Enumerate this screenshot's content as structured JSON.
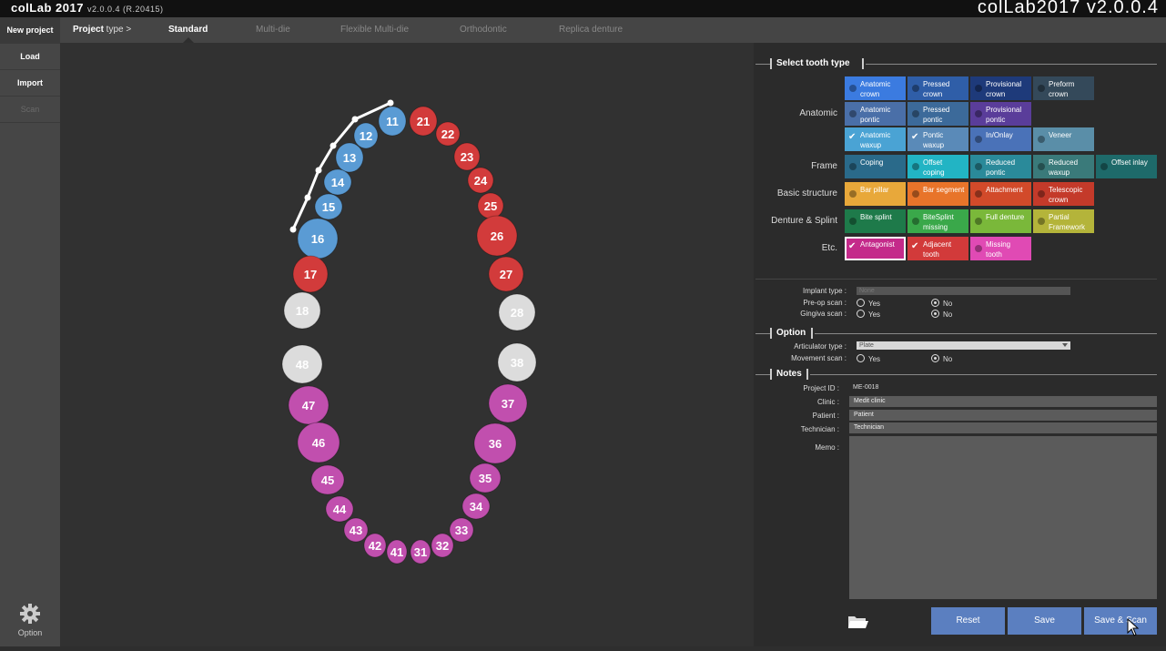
{
  "app": {
    "brand": "colLab 2017",
    "version": "v2.0.0.4 (R.20415)",
    "title_right": "colLab2017 v2.0.0.4"
  },
  "sidebar": {
    "items": [
      {
        "label": "New project"
      },
      {
        "label": "Load"
      },
      {
        "label": "Import"
      },
      {
        "label": "Scan"
      }
    ],
    "option_label": "Option"
  },
  "topbar": {
    "project_type_bold": "Project",
    "project_type_rest": " type >",
    "tabs": [
      "Standard",
      "Multi-die",
      "Flexible Multi-die",
      "Orthodontic",
      "Replica denture"
    ]
  },
  "teeth": {
    "upper": [
      {
        "n": "11",
        "c": "#5a9bd4"
      },
      {
        "n": "12",
        "c": "#5a9bd4"
      },
      {
        "n": "13",
        "c": "#5a9bd4"
      },
      {
        "n": "14",
        "c": "#5a9bd4"
      },
      {
        "n": "15",
        "c": "#5a9bd4"
      },
      {
        "n": "16",
        "c": "#5a9bd4"
      },
      {
        "n": "17",
        "c": "#d23b3b"
      },
      {
        "n": "18",
        "c": "#dcdcdc"
      },
      {
        "n": "21",
        "c": "#d23b3b"
      },
      {
        "n": "22",
        "c": "#d23b3b"
      },
      {
        "n": "23",
        "c": "#d23b3b"
      },
      {
        "n": "24",
        "c": "#d23b3b"
      },
      {
        "n": "25",
        "c": "#d23b3b"
      },
      {
        "n": "26",
        "c": "#d23b3b"
      },
      {
        "n": "27",
        "c": "#d23b3b"
      },
      {
        "n": "28",
        "c": "#dcdcdc"
      }
    ],
    "lower": [
      {
        "n": "48",
        "c": "#dcdcdc"
      },
      {
        "n": "47",
        "c": "#c14fae"
      },
      {
        "n": "46",
        "c": "#c14fae"
      },
      {
        "n": "45",
        "c": "#c14fae"
      },
      {
        "n": "44",
        "c": "#c14fae"
      },
      {
        "n": "43",
        "c": "#c14fae"
      },
      {
        "n": "42",
        "c": "#c14fae"
      },
      {
        "n": "41",
        "c": "#c14fae"
      },
      {
        "n": "31",
        "c": "#c14fae"
      },
      {
        "n": "32",
        "c": "#c14fae"
      },
      {
        "n": "33",
        "c": "#c14fae"
      },
      {
        "n": "34",
        "c": "#c14fae"
      },
      {
        "n": "35",
        "c": "#c14fae"
      },
      {
        "n": "36",
        "c": "#c14fae"
      },
      {
        "n": "37",
        "c": "#c14fae"
      },
      {
        "n": "38",
        "c": "#dcdcdc"
      }
    ]
  },
  "tooth_type": {
    "title": "Select tooth type",
    "rows": [
      {
        "label": "Anatomic",
        "buttons": [
          {
            "text": "Anatomic crown",
            "c": "#3b7be0"
          },
          {
            "text": "Pressed crown",
            "c": "#2f5ea8"
          },
          {
            "text": "Provisional crown",
            "c": "#1e3a7a"
          },
          {
            "text": "Preform crown",
            "c": "#34495a"
          },
          {
            "text": "Anatomic pontic",
            "c": "#4a6fa8"
          },
          {
            "text": "Pressed pontic",
            "c": "#3c6a9a"
          },
          {
            "text": "Provisional pontic",
            "c": "#5a3d9a"
          },
          {
            "text": "Anatomic waxup",
            "c": "#4aa3d4",
            "check": true
          },
          {
            "text": "Pontic waxup",
            "c": "#5a8ab8",
            "check": true
          },
          {
            "text": "In/Onlay",
            "c": "#4a72b8"
          },
          {
            "text": "Veneer",
            "c": "#5a8ea8"
          }
        ]
      },
      {
        "label": "Frame",
        "buttons": [
          {
            "text": "Coping",
            "c": "#2a6a8a"
          },
          {
            "text": "Offset coping",
            "c": "#22b4c4"
          },
          {
            "text": "Reduced pontic",
            "c": "#2a8a9a"
          },
          {
            "text": "Reduced waxup",
            "c": "#3a7a7a"
          },
          {
            "text": "Offset inlay",
            "c": "#1e6a6a"
          }
        ]
      },
      {
        "label": "Basic structure",
        "buttons": [
          {
            "text": "Bar pillar",
            "c": "#e8a83a"
          },
          {
            "text": "Bar segment",
            "c": "#e8742a"
          },
          {
            "text": "Attachment",
            "c": "#d24a2a"
          },
          {
            "text": "Telescopic crown",
            "c": "#c43a2a"
          }
        ]
      },
      {
        "label": "Denture & Splint",
        "buttons": [
          {
            "text": "Bite splint",
            "c": "#1e7a4a"
          },
          {
            "text": "BiteSplint missing",
            "c": "#3aa84a"
          },
          {
            "text": "Full denture",
            "c": "#7ab83a"
          },
          {
            "text": "Partial Framework",
            "c": "#b4b43a"
          }
        ]
      },
      {
        "label": "Etc.",
        "buttons": [
          {
            "text": "Antagonist",
            "c": "#c42a8a",
            "check": true,
            "selected": true
          },
          {
            "text": "Adjacent tooth",
            "c": "#d23a3a",
            "check": true
          },
          {
            "text": "Missing tooth",
            "c": "#e04ab4"
          }
        ]
      }
    ]
  },
  "implant": {
    "type_label": "Implant type :",
    "type_value": "None",
    "preop_label": "Pre-op scan :",
    "gingiva_label": "Gingiva scan :",
    "yes": "Yes",
    "no": "No"
  },
  "option": {
    "title": "Option",
    "articulator_label": "Articulator type :",
    "articulator_value": "Plate",
    "movement_label": "Movement scan :",
    "yes": "Yes",
    "no": "No"
  },
  "notes": {
    "title": "Notes",
    "project_id_label": "Project ID :",
    "project_id": "ME-0018",
    "clinic_label": "Clinic :",
    "clinic": "Medit clinic",
    "patient_label": "Patient :",
    "patient": "Patient",
    "technician_label": "Technician :",
    "technician": "Technician",
    "memo_label": "Memo :"
  },
  "actions": {
    "reset": "Reset",
    "save": "Save",
    "save_scan": "Save & Scan"
  }
}
